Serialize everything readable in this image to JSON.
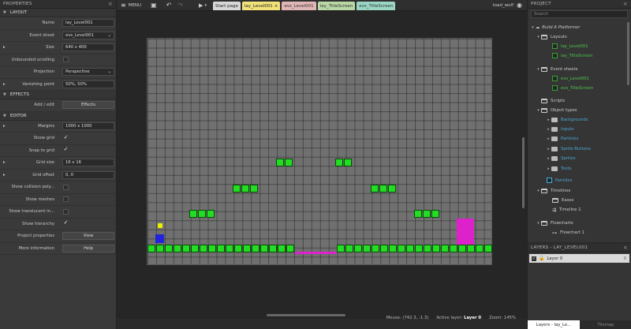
{
  "properties": {
    "title": "PROPERTIES",
    "sections": {
      "layout": "LAYOUT",
      "effects": "EFFECTS",
      "editor": "EDITOR"
    },
    "rows": {
      "name": {
        "label": "Name",
        "value": "lay_Level001"
      },
      "event_sheet": {
        "label": "Event sheet",
        "value": "evs_Level001"
      },
      "size": {
        "label": "Size",
        "value": "640 x 400"
      },
      "unbounded": {
        "label": "Unbounded scrolling",
        "checked": false
      },
      "projection": {
        "label": "Projection",
        "value": "Perspective"
      },
      "vanishing": {
        "label": "Vanishing point",
        "value": "50%, 50%"
      },
      "add_edit": {
        "label": "Add / edit",
        "value": "Effects"
      },
      "margins": {
        "label": "Margins",
        "value": "1000 x 1000"
      },
      "show_grid": {
        "label": "Show grid",
        "checked": true
      },
      "snap_grid": {
        "label": "Snap to grid",
        "checked": true
      },
      "grid_size": {
        "label": "Grid size",
        "value": "16 x 16"
      },
      "grid_offset": {
        "label": "Grid offset",
        "value": "0, 0"
      },
      "show_collision": {
        "label": "Show collision poly...",
        "checked": false
      },
      "show_meshes": {
        "label": "Show meshes",
        "checked": false
      },
      "show_translucent": {
        "label": "Show translucent in...",
        "checked": false
      },
      "show_hierarchy": {
        "label": "Show hierarchy",
        "checked": true
      },
      "project_props": {
        "label": "Project properties",
        "value": "View"
      },
      "more_info": {
        "label": "More information",
        "value": "Help"
      }
    }
  },
  "toolbar": {
    "menu": "MENU",
    "user": "toad_wolf",
    "tabs": [
      {
        "label": "Start page",
        "active": false,
        "bg": "#d8d8d8",
        "fg": "#222222"
      },
      {
        "label": "lay_Level001",
        "active": true,
        "bg": "#f2e27a",
        "fg": "#222222"
      },
      {
        "label": "evs_Level001",
        "active": false,
        "bg": "#e2b6b6",
        "fg": "#333333"
      },
      {
        "label": "lay_TitleScreen",
        "active": false,
        "bg": "#b9d8a6",
        "fg": "#333333"
      },
      {
        "label": "evs_TitleScreen",
        "active": false,
        "bg": "#9ad6c4",
        "fg": "#333333"
      }
    ]
  },
  "colors": {
    "platform_green": "#22dd22",
    "pink": "#dd22cc",
    "player_blue": "#2222dd",
    "coin_yellow": "#eeee00"
  },
  "status": {
    "mouse": "Mouse: (742.3, -1.3)",
    "active_layer_label": "Active layer:",
    "active_layer": "Layer 0",
    "zoom": "Zoom: 145%"
  },
  "project": {
    "title": "PROJECT",
    "search_placeholder": "Search",
    "root": "Build A Platformer",
    "layouts": "Layouts",
    "layout_items": [
      "lay_Level001",
      "lay_TitleScreen"
    ],
    "event_sheets": "Event sheets",
    "event_items": [
      "evs_Level001",
      "evs_TitleScreen"
    ],
    "scripts": "Scripts",
    "object_types": "Object types",
    "object_items": [
      "Backgrounds",
      "Inputs",
      "Particles",
      "Sprite Buttons",
      "Sprites",
      "Texts"
    ],
    "families": "Families",
    "timelines": "Timelines",
    "eases": "Eases",
    "timeline1": "Timeline 1",
    "flowcharts": "Flowcharts",
    "flowchart1": "Flowchart 1"
  },
  "layers": {
    "title": "LAYERS - LAY_LEVEL001",
    "items": [
      {
        "name": "Layer 0",
        "visible": true,
        "locked": false,
        "index": "0"
      }
    ],
    "tabs": [
      "Layers - lay_Le...",
      "Tilemap"
    ]
  }
}
